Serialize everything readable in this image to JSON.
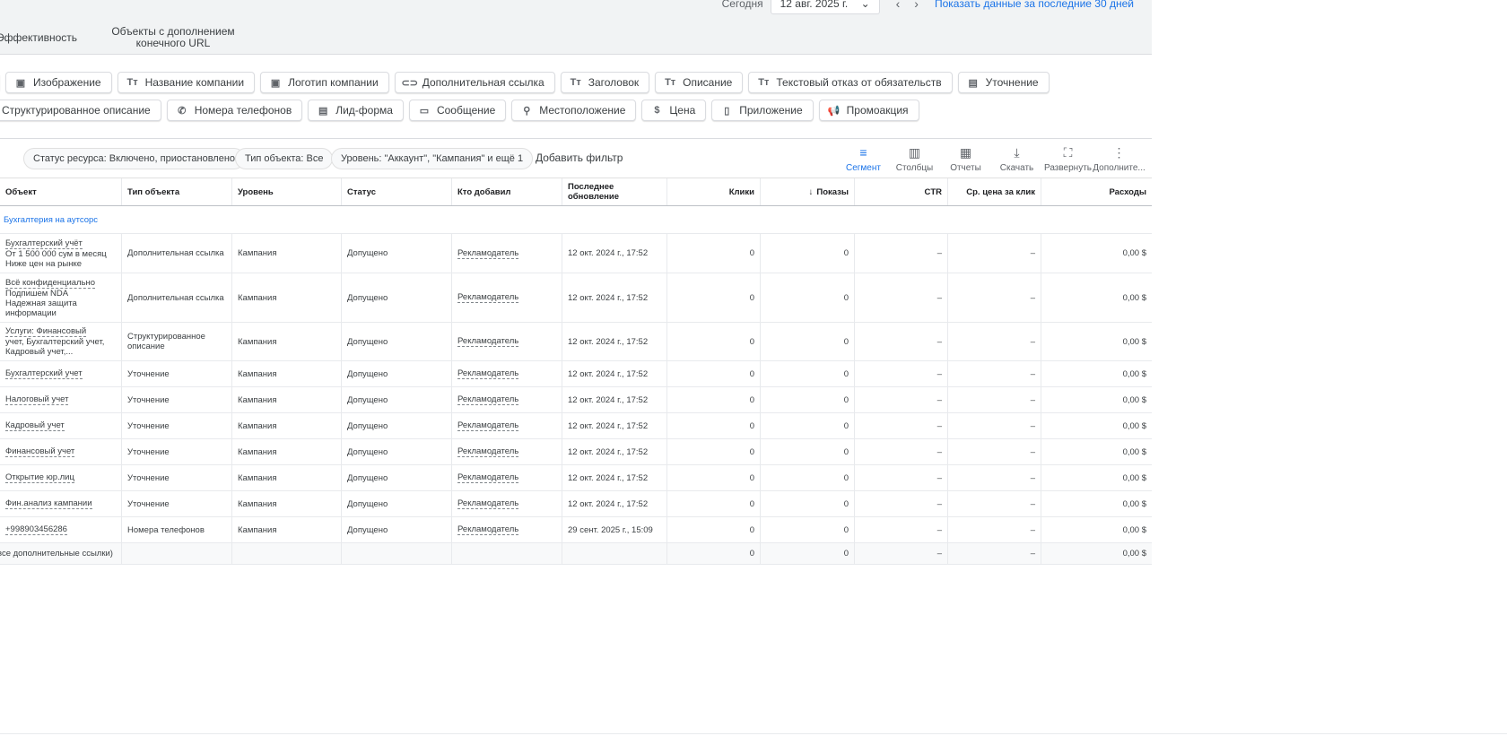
{
  "header": {
    "today_label": "Сегодня",
    "date_value": "12 авг. 2025 г.",
    "date_icon": "chevron-down-icon",
    "last30_link": "Показать данные за последние 30 дней",
    "tabs": [
      {
        "label": "Эффективность"
      },
      {
        "label": "Объекты с дополнением конечного URL"
      }
    ]
  },
  "chips": {
    "row1": [
      {
        "label": "",
        "icon": "chip-edge"
      },
      {
        "label": "Изображение",
        "icon": "image-icon",
        "glyph": "▣"
      },
      {
        "label": "Название компании",
        "icon": "text-icon",
        "glyph": "Tт"
      },
      {
        "label": "Логотип компании",
        "icon": "image-icon",
        "glyph": "▣"
      },
      {
        "label": "Дополнительная ссылка",
        "icon": "link-icon",
        "glyph": "⊂⊃"
      },
      {
        "label": "Заголовок",
        "icon": "text-icon",
        "glyph": "Tт"
      },
      {
        "label": "Описание",
        "icon": "text-icon",
        "glyph": "Tт"
      },
      {
        "label": "Текстовый отказ от обязательств",
        "icon": "text-icon",
        "glyph": "Tт"
      },
      {
        "label": "Уточнение",
        "icon": "document-icon",
        "glyph": "▤"
      }
    ],
    "row2": [
      {
        "label": "Структурированное описание",
        "icon": "",
        "glyph": ""
      },
      {
        "label": "Номера телефонов",
        "icon": "phone-icon",
        "glyph": "✆"
      },
      {
        "label": "Лид-форма",
        "icon": "form-icon",
        "glyph": "▤"
      },
      {
        "label": "Сообщение",
        "icon": "message-icon",
        "glyph": "▭"
      },
      {
        "label": "Местоположение",
        "icon": "location-pin-icon",
        "glyph": "⚲"
      },
      {
        "label": "Цена",
        "icon": "price-icon",
        "glyph": "$"
      },
      {
        "label": "Приложение",
        "icon": "phone-app-icon",
        "glyph": "▯"
      },
      {
        "label": "Промоакция",
        "icon": "megaphone-icon",
        "glyph": "📢"
      }
    ]
  },
  "filters": {
    "status": "Статус ресурса: Включено, приостановлено",
    "type": "Тип объекта: Все",
    "level": "Уровень: \"Аккаунт\", \"Кампания\" и ещё 1",
    "add_filter": "Добавить фильтр"
  },
  "toolbar": [
    {
      "label": "Сегмент",
      "icon": "segment-icon",
      "glyph": "≡",
      "active": true
    },
    {
      "label": "Столбцы",
      "icon": "columns-icon",
      "glyph": "▥",
      "active": false
    },
    {
      "label": "Отчеты",
      "icon": "reports-icon",
      "glyph": "▦",
      "active": false
    },
    {
      "label": "Скачать",
      "icon": "download-icon",
      "glyph": "⤓",
      "active": false
    },
    {
      "label": "Развернуть",
      "icon": "fullscreen-icon",
      "glyph": "⛶",
      "active": false
    },
    {
      "label": "Дополните...",
      "icon": "more-vert-icon",
      "glyph": "⋮",
      "active": false
    }
  ],
  "table": {
    "columns": [
      "Объект",
      "Тип объекта",
      "Уровень",
      "Статус",
      "Кто добавил",
      "Последнее обновление",
      "Клики",
      "Показы",
      "CTR",
      "Ср. цена за клик",
      "Расходы"
    ],
    "sorted_column_icon": "arrow-down-icon",
    "group_label": "Бухгалтерия на аутсорс",
    "rows": [
      {
        "object_lines": [
          "Бухгалтерский учёт",
          "От 1 500 000 сум в месяц",
          "Ниже цен на рынке"
        ],
        "type": "Дополнительная ссылка",
        "level": "Кампания",
        "status": "Допущено",
        "added_by": "Рекламодатель",
        "updated": "12 окт. 2024 г., 17:52",
        "clicks": "0",
        "impressions": "0",
        "ctr": "–",
        "cpc": "–",
        "cost": "0,00 $"
      },
      {
        "object_lines": [
          "Всё конфиденциально",
          "Подпишем NDA",
          "Надежная защита",
          "информации"
        ],
        "type": "Дополнительная ссылка",
        "level": "Кампания",
        "status": "Допущено",
        "added_by": "Рекламодатель",
        "updated": "12 окт. 2024 г., 17:52",
        "clicks": "0",
        "impressions": "0",
        "ctr": "–",
        "cpc": "–",
        "cost": "0,00 $"
      },
      {
        "object_lines": [
          "Услуги: Финансовый",
          "учет, Бухгалтерский учет,",
          "Кадровый учет,..."
        ],
        "type": "Структурированное описание",
        "level": "Кампания",
        "status": "Допущено",
        "added_by": "Рекламодатель",
        "updated": "12 окт. 2024 г., 17:52",
        "clicks": "0",
        "impressions": "0",
        "ctr": "–",
        "cpc": "–",
        "cost": "0,00 $"
      },
      {
        "object_lines": [
          "Бухгалтерский учет"
        ],
        "type": "Уточнение",
        "level": "Кампания",
        "status": "Допущено",
        "added_by": "Рекламодатель",
        "updated": "12 окт. 2024 г., 17:52",
        "clicks": "0",
        "impressions": "0",
        "ctr": "–",
        "cpc": "–",
        "cost": "0,00 $"
      },
      {
        "object_lines": [
          "Налоговый учет"
        ],
        "type": "Уточнение",
        "level": "Кампания",
        "status": "Допущено",
        "added_by": "Рекламодатель",
        "updated": "12 окт. 2024 г., 17:52",
        "clicks": "0",
        "impressions": "0",
        "ctr": "–",
        "cpc": "–",
        "cost": "0,00 $"
      },
      {
        "object_lines": [
          "Кадровый учет"
        ],
        "type": "Уточнение",
        "level": "Кампания",
        "status": "Допущено",
        "added_by": "Рекламодатель",
        "updated": "12 окт. 2024 г., 17:52",
        "clicks": "0",
        "impressions": "0",
        "ctr": "–",
        "cpc": "–",
        "cost": "0,00 $"
      },
      {
        "object_lines": [
          "Финансовый учет"
        ],
        "type": "Уточнение",
        "level": "Кампания",
        "status": "Допущено",
        "added_by": "Рекламодатель",
        "updated": "12 окт. 2024 г., 17:52",
        "clicks": "0",
        "impressions": "0",
        "ctr": "–",
        "cpc": "–",
        "cost": "0,00 $"
      },
      {
        "object_lines": [
          "Открытие юр.лиц"
        ],
        "type": "Уточнение",
        "level": "Кампания",
        "status": "Допущено",
        "added_by": "Рекламодатель",
        "updated": "12 окт. 2024 г., 17:52",
        "clicks": "0",
        "impressions": "0",
        "ctr": "–",
        "cpc": "–",
        "cost": "0,00 $"
      },
      {
        "object_lines": [
          "Фин.анализ кампании"
        ],
        "type": "Уточнение",
        "level": "Кампания",
        "status": "Допущено",
        "added_by": "Рекламодатель",
        "updated": "12 окт. 2024 г., 17:52",
        "clicks": "0",
        "impressions": "0",
        "ctr": "–",
        "cpc": "–",
        "cost": "0,00 $"
      },
      {
        "object_lines": [
          "+998903456286"
        ],
        "type": "Номера телефонов",
        "level": "Кампания",
        "status": "Допущено",
        "added_by": "Рекламодатель",
        "updated": "29 сент. 2025 г., 15:09",
        "clicks": "0",
        "impressions": "0",
        "ctr": "–",
        "cpc": "–",
        "cost": "0,00 $"
      }
    ],
    "total": {
      "label": "все дополнительные ссылки)",
      "clicks": "0",
      "impressions": "0",
      "ctr": "–",
      "cpc": "–",
      "cost": "0,00 $"
    }
  },
  "colors": {
    "accent": "#1a73e8",
    "header_bg": "#f1f3f4",
    "border": "#dadce0"
  }
}
